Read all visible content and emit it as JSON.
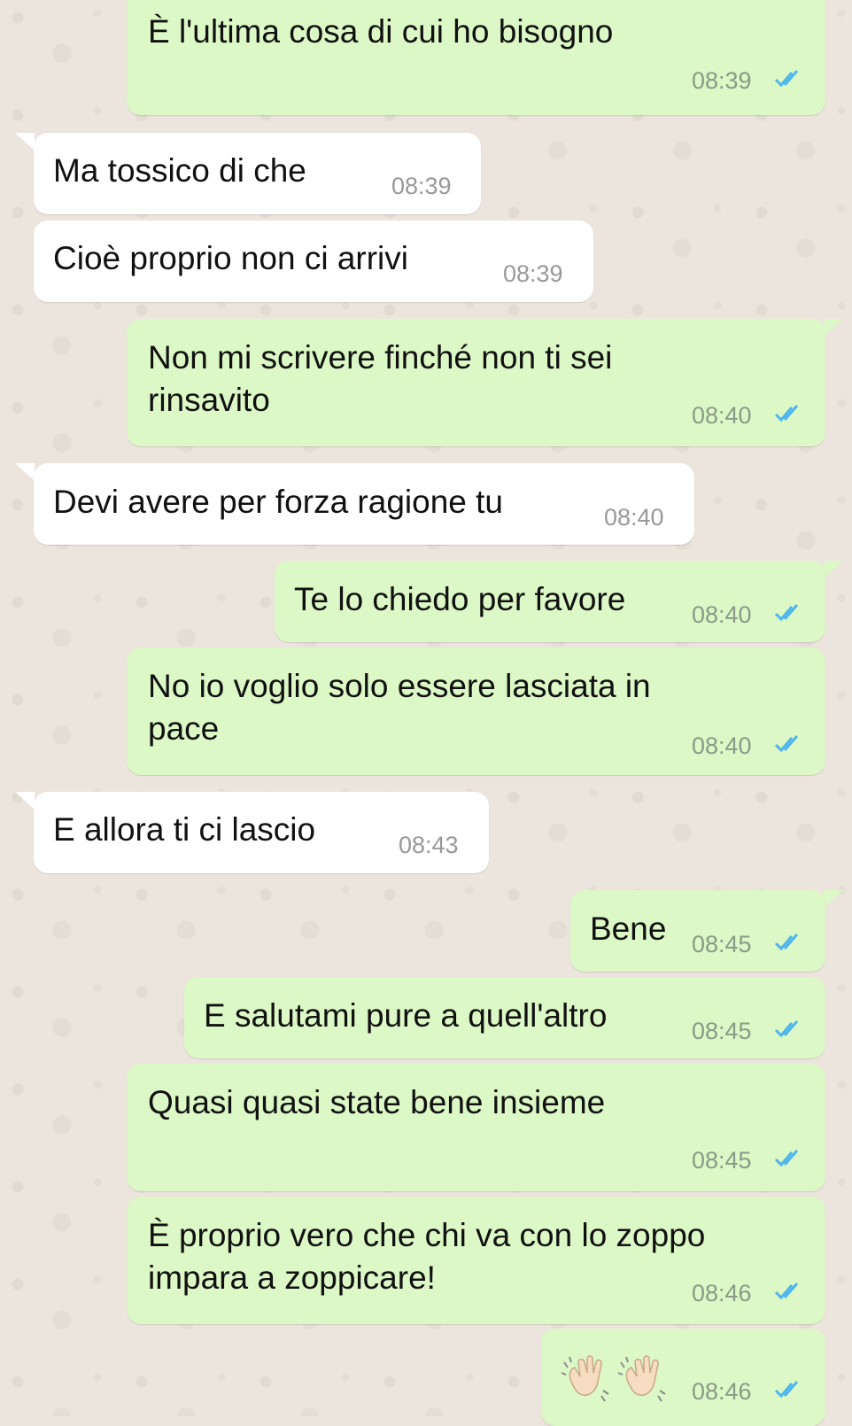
{
  "colors": {
    "outgoing_bubble": "#dcf8c6",
    "incoming_bubble": "#ffffff",
    "read_ticks": "#4fb6ec",
    "wallpaper": "#ece5dd"
  },
  "messages": [
    {
      "direction": "out",
      "text": "È l'ultima cosa di cui ho bisogno",
      "time": "08:39",
      "status": "read"
    },
    {
      "direction": "in",
      "text": "Ma tossico di che",
      "time": "08:39"
    },
    {
      "direction": "in",
      "text": "Cioè proprio non ci arrivi",
      "time": "08:39"
    },
    {
      "direction": "out",
      "line1": "Non mi scrivere finché non ti sei",
      "line2": "rinsavito",
      "time": "08:40",
      "status": "read"
    },
    {
      "direction": "in",
      "text": "Devi avere per forza ragione tu",
      "time": "08:40"
    },
    {
      "direction": "out",
      "text": "Te lo chiedo per favore",
      "time": "08:40",
      "status": "read"
    },
    {
      "direction": "out",
      "line1": "No io voglio solo essere lasciata in",
      "line2": "pace",
      "time": "08:40",
      "status": "read"
    },
    {
      "direction": "in",
      "text": "E allora ti ci lascio",
      "time": "08:43"
    },
    {
      "direction": "out",
      "text": "Bene",
      "time": "08:45",
      "status": "read"
    },
    {
      "direction": "out",
      "text": "E salutami pure a quell'altro",
      "time": "08:45",
      "status": "read"
    },
    {
      "direction": "out",
      "text": "Quasi quasi state bene insieme",
      "time": "08:45",
      "status": "read"
    },
    {
      "direction": "out",
      "line1": "È proprio vero che chi va con lo zoppo",
      "line2": "impara a zoppicare!",
      "time": "08:46",
      "status": "read"
    },
    {
      "direction": "out",
      "emoji": [
        "waving-hand-icon",
        "waving-hand-icon"
      ],
      "time": "08:46",
      "status": "read"
    }
  ]
}
